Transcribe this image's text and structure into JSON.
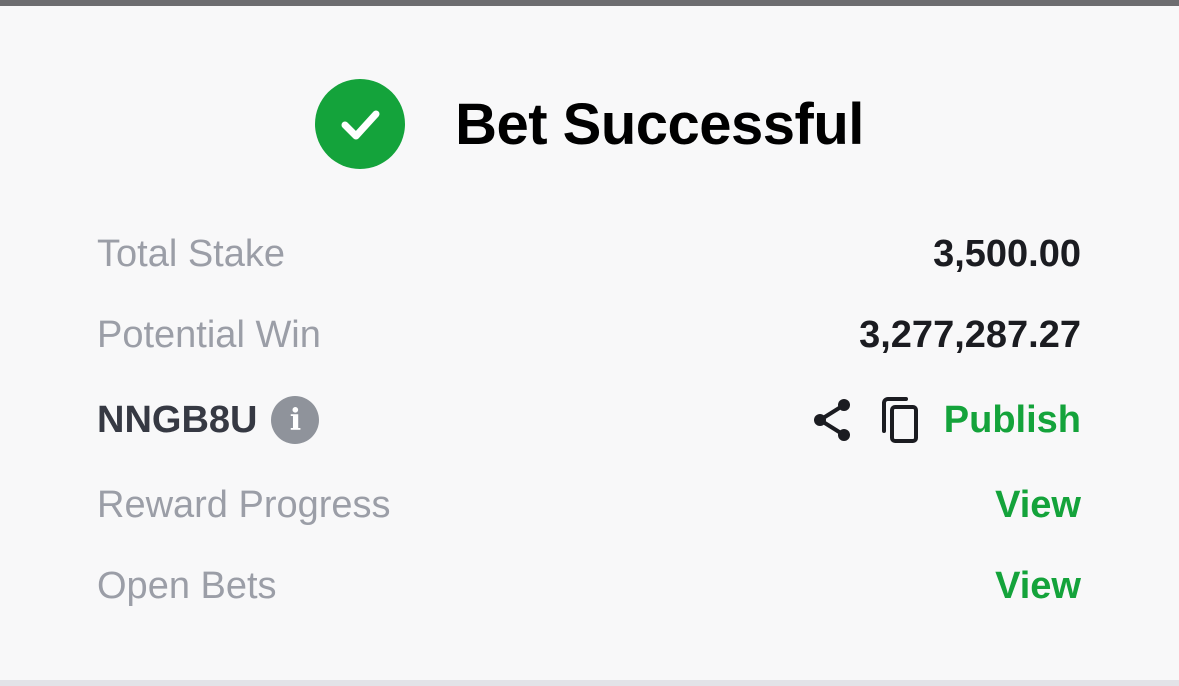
{
  "header": {
    "title": "Bet Successful",
    "icon": "check-circle-icon",
    "accent": "#14a33b"
  },
  "summary": {
    "total_stake_label": "Total Stake",
    "total_stake_value": "3,500.00",
    "potential_win_label": "Potential Win",
    "potential_win_value": "3,277,287.27"
  },
  "booking": {
    "code": "NNGB8U",
    "info_icon": "info-icon",
    "share_icon": "share-icon",
    "copy_icon": "copy-icon",
    "publish_label": "Publish"
  },
  "links": {
    "reward_progress_label": "Reward Progress",
    "reward_progress_action": "View",
    "open_bets_label": "Open Bets",
    "open_bets_action": "View"
  }
}
